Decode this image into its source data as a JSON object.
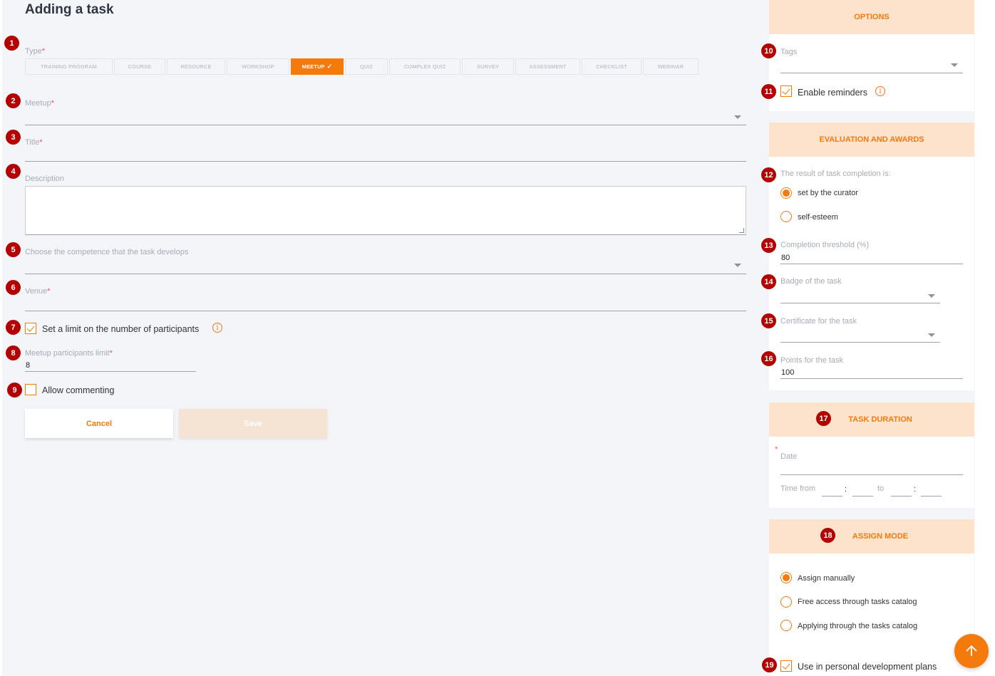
{
  "page_title": "Adding a task",
  "markers": [
    "1",
    "2",
    "3",
    "4",
    "5",
    "6",
    "7",
    "8",
    "9",
    "10",
    "11",
    "12",
    "13",
    "14",
    "15",
    "16",
    "17",
    "18",
    "19"
  ],
  "form": {
    "type_label": "Type",
    "types": [
      "TRAINING PROGRAM",
      "COURSE",
      "RESOURCE",
      "WORKSHOP",
      "MEETUP",
      "QUIZ",
      "COMPLEX QUIZ",
      "SURVEY",
      "ASSESSMENT",
      "CHECKLIST",
      "WEBINAR"
    ],
    "selected_type": "MEETUP",
    "meetup_label": "Meetup",
    "title_label": "Title",
    "description_label": "Description",
    "competence_label": "Choose the competence that the task develops",
    "venue_label": "Venue",
    "limit_checkbox_label": "Set a limit on the number of participants",
    "limit_checked": true,
    "participants_limit_label": "Meetup participants limit",
    "participants_limit_value": "8",
    "allow_commenting_label": "Allow commenting",
    "allow_commenting_checked": false,
    "required_mark": "*",
    "info_glyph": "i"
  },
  "buttons": {
    "cancel": "Cancel",
    "save": "Save"
  },
  "options": {
    "header": "OPTIONS",
    "tags_label": "Tags",
    "reminders_label": "Enable reminders",
    "reminders_checked": true
  },
  "evaluation": {
    "header": "EVALUATION AND AWARDS",
    "result_label": "The result of task completion is:",
    "result_options": [
      "set by the curator",
      "self-esteem"
    ],
    "result_selected": 0,
    "threshold_label": "Completion threshold (%)",
    "threshold_value": "80",
    "badge_label": "Badge of the task",
    "certificate_label": "Certificate for the task",
    "points_label": "Points for the task",
    "points_value": "100"
  },
  "duration": {
    "header": "TASK DURATION",
    "date_label": "Date",
    "time_from_label": "Time from",
    "time_to_label": "to",
    "time_sep": ":"
  },
  "assign": {
    "header": "ASSIGN MODE",
    "options": [
      "Assign manually",
      "Free access through tasks catalog",
      "Applying through the tasks catalog"
    ],
    "selected": 0,
    "pdp_label": "Use in personal development plans",
    "pdp_checked": true
  },
  "colors": {
    "accent": "#f57a0c",
    "marker": "#b30000",
    "panel_header_bg": "#fde3cc",
    "page_bg": "#f4f5f9"
  },
  "icons": {
    "scroll_top": "arrow-up-icon",
    "dropdown": "chevron-down-icon"
  }
}
